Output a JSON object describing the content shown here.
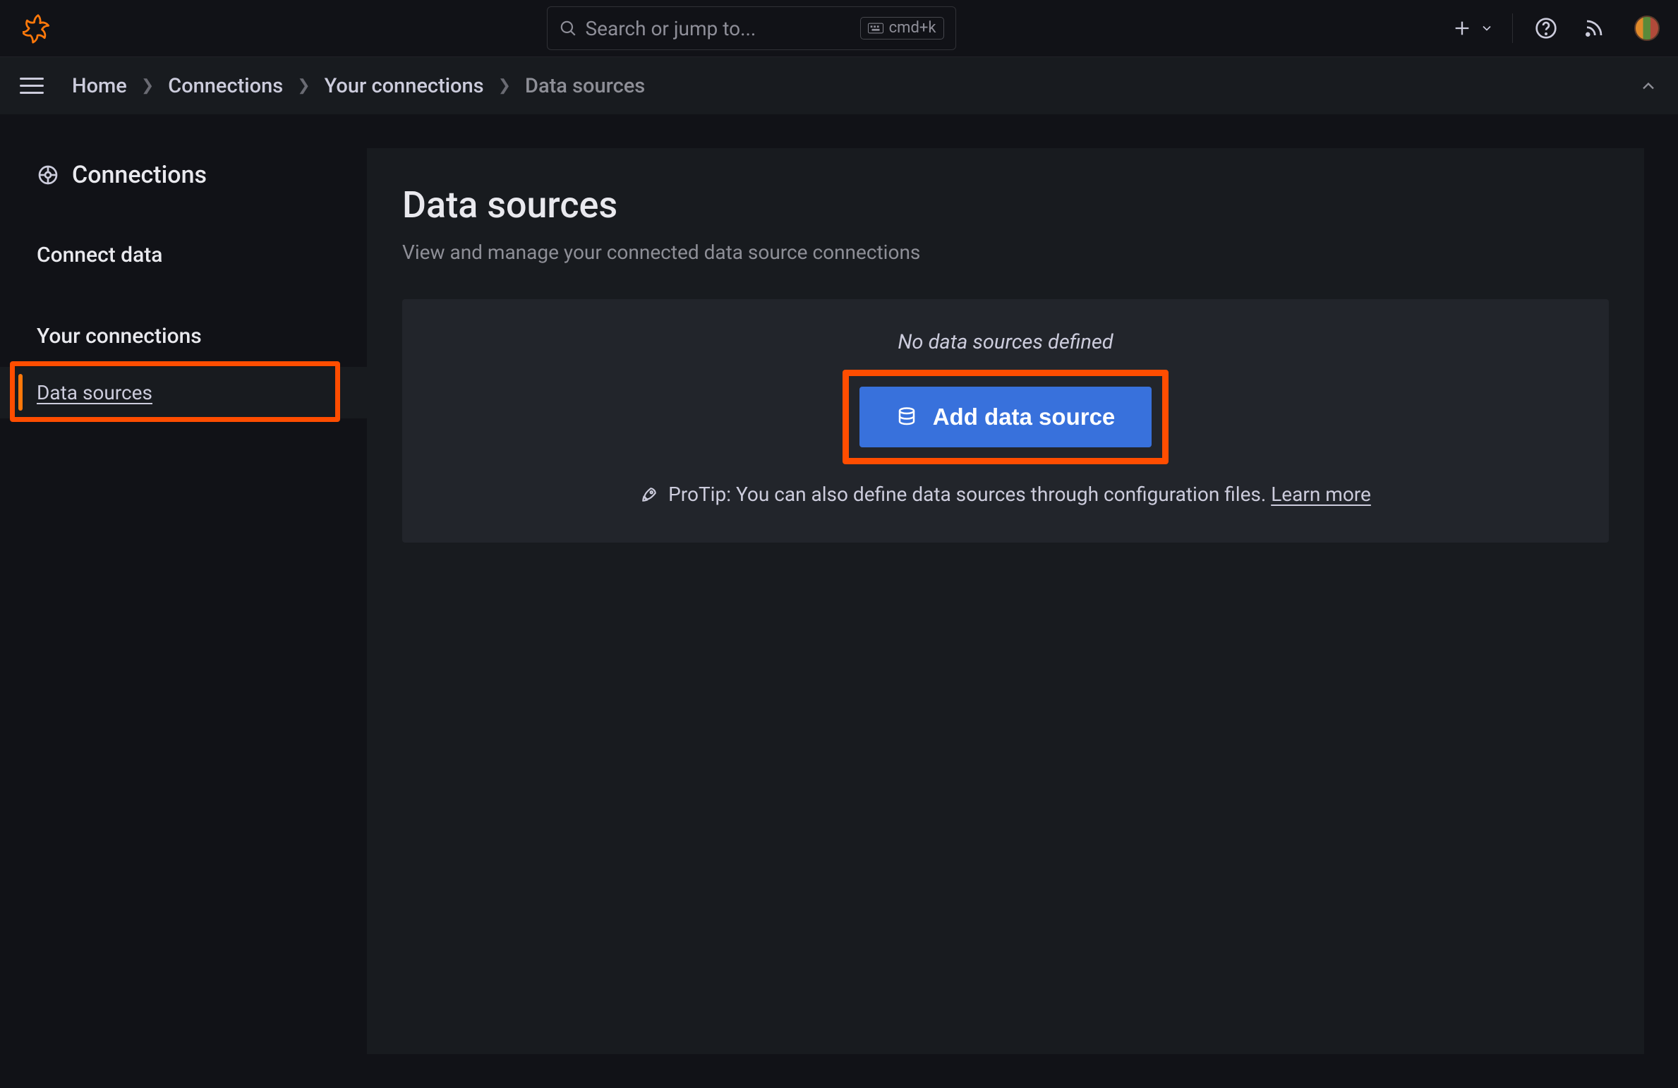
{
  "search": {
    "placeholder": "Search or jump to...",
    "shortcut": "cmd+k"
  },
  "breadcrumbs": {
    "items": [
      "Home",
      "Connections",
      "Your connections",
      "Data sources"
    ]
  },
  "sidebar": {
    "title": "Connections",
    "items": [
      "Connect data",
      "Your connections"
    ],
    "subitem": "Data sources"
  },
  "page": {
    "title": "Data sources",
    "subtitle": "View and manage your connected data source connections"
  },
  "empty": {
    "message": "No data sources defined",
    "button": "Add data source",
    "protip_prefix": "ProTip: You can also define data sources through configuration files. ",
    "protip_link": "Learn more"
  }
}
